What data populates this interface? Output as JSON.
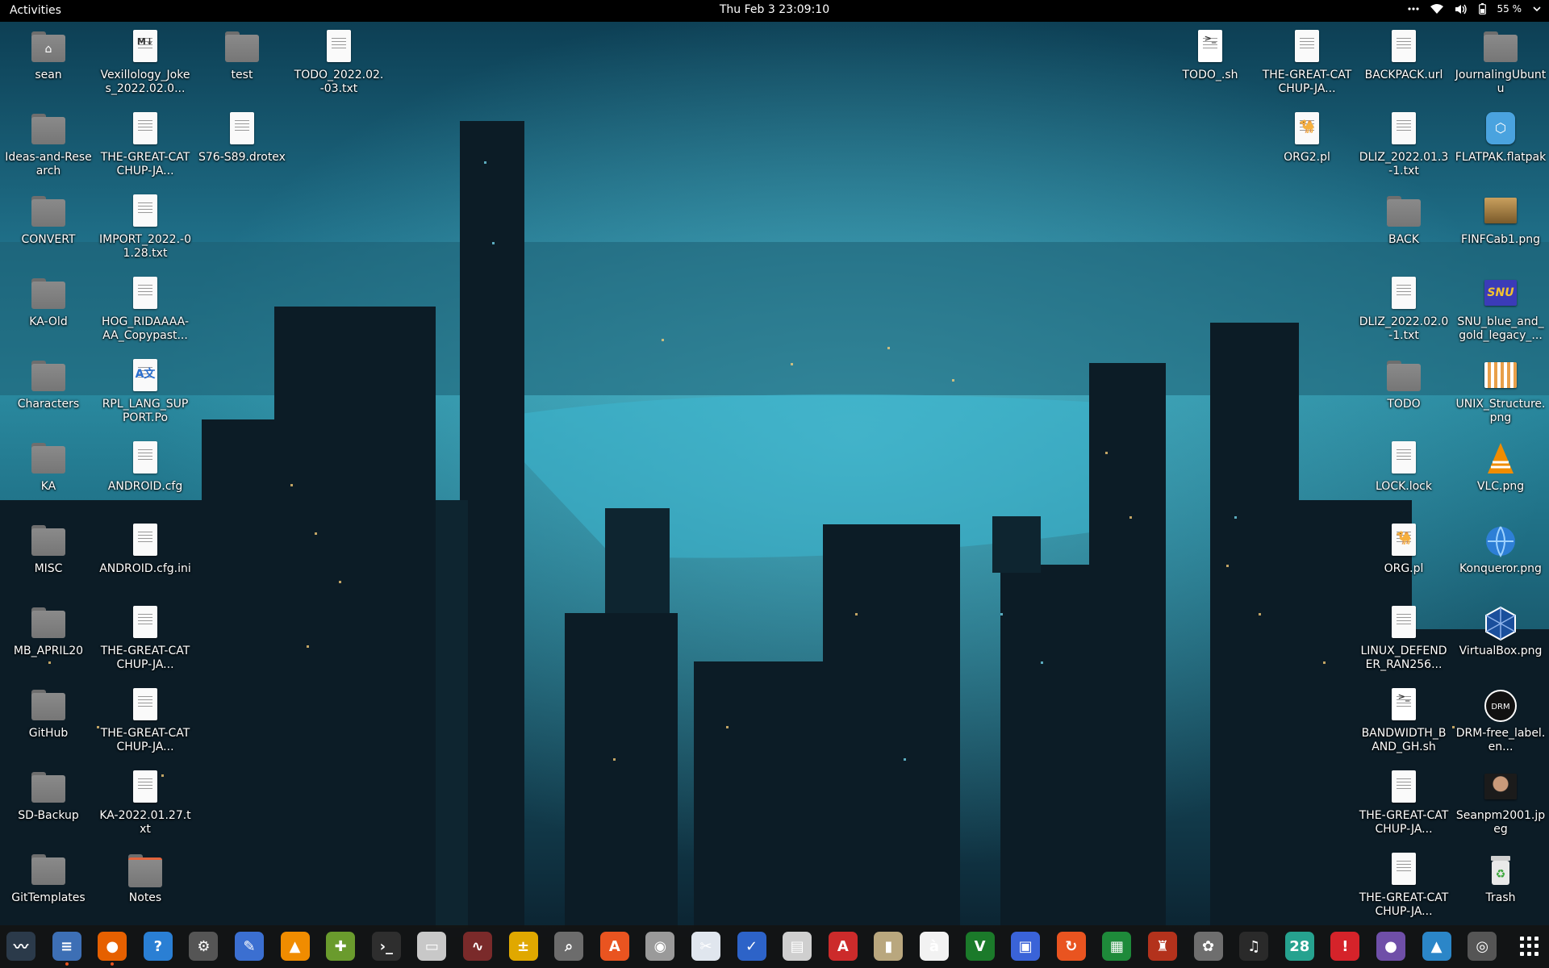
{
  "topbar": {
    "activities": "Activities",
    "clock": "Thu Feb 3  23:09:10",
    "battery": "55 %",
    "icons": [
      "more-icon",
      "wifi-icon",
      "volume-icon",
      "battery-icon",
      "system-menu-chevron-icon"
    ]
  },
  "desktop_icons": [
    {
      "label": "sean",
      "kind": "folder-home",
      "col": 0,
      "row": 0
    },
    {
      "label": "Ideas-and-Research",
      "kind": "folder",
      "col": 0,
      "row": 1
    },
    {
      "label": "CONVERT",
      "kind": "folder",
      "col": 0,
      "row": 2
    },
    {
      "label": "KA-Old",
      "kind": "folder",
      "col": 0,
      "row": 3
    },
    {
      "label": "Characters",
      "kind": "folder",
      "col": 0,
      "row": 4
    },
    {
      "label": "KA",
      "kind": "folder",
      "col": 0,
      "row": 5
    },
    {
      "label": "MISC",
      "kind": "folder",
      "col": 0,
      "row": 6
    },
    {
      "label": "MB_APRIL20",
      "kind": "folder",
      "col": 0,
      "row": 7
    },
    {
      "label": "GitHub",
      "kind": "folder",
      "col": 0,
      "row": 8
    },
    {
      "label": "SD-Backup",
      "kind": "folder",
      "col": 0,
      "row": 9
    },
    {
      "label": "GitTemplates",
      "kind": "folder",
      "col": 0,
      "row": 10
    },
    {
      "label": "Vexillology_Jokes_2022.02.0...",
      "kind": "markdown",
      "col": 1,
      "row": 0
    },
    {
      "label": "THE-GREAT-CATCHUP-JA...",
      "kind": "doc",
      "col": 1,
      "row": 1
    },
    {
      "label": "IMPORT_2022.-01.28.txt",
      "kind": "doc",
      "col": 1,
      "row": 2
    },
    {
      "label": "HOG_RIDAAAA-AA_Copypast...",
      "kind": "doc",
      "col": 1,
      "row": 3
    },
    {
      "label": "RPL_LANG_SUPPORT.Po",
      "kind": "translation",
      "col": 1,
      "row": 4
    },
    {
      "label": "ANDROID.cfg",
      "kind": "doc",
      "col": 1,
      "row": 5
    },
    {
      "label": "ANDROID.cfg.ini",
      "kind": "doc",
      "col": 1,
      "row": 6
    },
    {
      "label": "THE-GREAT-CATCHUP-JA...",
      "kind": "doc",
      "col": 1,
      "row": 7
    },
    {
      "label": "THE-GREAT-CATCHUP-JA...",
      "kind": "doc",
      "col": 1,
      "row": 8
    },
    {
      "label": "KA-2022.01.27.txt",
      "kind": "doc",
      "col": 1,
      "row": 9
    },
    {
      "label": "Notes",
      "kind": "folder-accent",
      "col": 1,
      "row": 10
    },
    {
      "label": "test",
      "kind": "folder",
      "col": 2,
      "row": 0
    },
    {
      "label": "S76-S89.drotex",
      "kind": "doc",
      "col": 2,
      "row": 1
    },
    {
      "label": "TODO_2022.02.-03.txt",
      "kind": "doc",
      "col": 3,
      "row": 0
    },
    {
      "label": "TODO_.sh",
      "kind": "script",
      "col": 12,
      "row": 0
    },
    {
      "label": "THE-GREAT-CATCHUP-JA...",
      "kind": "doc",
      "col": 13,
      "row": 0
    },
    {
      "label": "ORG2.pl",
      "kind": "perl",
      "col": 13,
      "row": 1
    },
    {
      "label": "BACKPACK.url",
      "kind": "doc",
      "col": 14,
      "row": 0
    },
    {
      "label": "DLIZ_2022.01.3-1.txt",
      "kind": "doc",
      "col": 14,
      "row": 1
    },
    {
      "label": "BACK",
      "kind": "folder",
      "col": 14,
      "row": 2
    },
    {
      "label": "DLIZ_2022.02.0-1.txt",
      "kind": "doc",
      "col": 14,
      "row": 3
    },
    {
      "label": "TODO",
      "kind": "folder",
      "col": 14,
      "row": 4
    },
    {
      "label": "LOCK.lock",
      "kind": "doc",
      "col": 14,
      "row": 5
    },
    {
      "label": "ORG.pl",
      "kind": "perl",
      "col": 14,
      "row": 6
    },
    {
      "label": "LINUX_DEFENDER_RAN256...",
      "kind": "doc",
      "col": 14,
      "row": 7
    },
    {
      "label": "BANDWIDTH_BAND_GH.sh",
      "kind": "script",
      "col": 14,
      "row": 8
    },
    {
      "label": "THE-GREAT-CATCHUP-JA...",
      "kind": "doc",
      "col": 14,
      "row": 9
    },
    {
      "label": "THE-GREAT-CATCHUP-JA...",
      "kind": "doc",
      "col": 14,
      "row": 10
    },
    {
      "label": "JournalingUbuntu",
      "kind": "folder",
      "col": 15,
      "row": 0
    },
    {
      "label": "FLATPAK.flatpak",
      "kind": "flatpak",
      "col": 15,
      "row": 1
    },
    {
      "label": "FINFCab1.png",
      "kind": "img-cabinet",
      "col": 15,
      "row": 2
    },
    {
      "label": "SNU_blue_and_gold_legacy_...",
      "kind": "img-snu",
      "col": 15,
      "row": 3
    },
    {
      "label": "UNIX_Structure.png",
      "kind": "img-chart",
      "col": 15,
      "row": 4
    },
    {
      "label": "VLC.png",
      "kind": "img-vlc",
      "col": 15,
      "row": 5
    },
    {
      "label": "Konqueror.png",
      "kind": "img-globe",
      "col": 15,
      "row": 6
    },
    {
      "label": "VirtualBox.png",
      "kind": "img-vbox",
      "col": 15,
      "row": 7
    },
    {
      "label": "DRM-free_label.en...",
      "kind": "img-drm",
      "col": 15,
      "row": 8
    },
    {
      "label": "Seanpm2001.jpeg",
      "kind": "img-photo",
      "col": 15,
      "row": 9
    },
    {
      "label": "Trash",
      "kind": "trash",
      "col": 15,
      "row": 10
    }
  ],
  "dock": [
    {
      "name": "system-monitor",
      "color": "#2b3a4a",
      "glyph": "〰",
      "running": false
    },
    {
      "name": "text-editor-docs",
      "color": "#3d6fb5",
      "glyph": "≡",
      "running": true
    },
    {
      "name": "firefox",
      "color": "#e66000",
      "glyph": "●",
      "running": true
    },
    {
      "name": "help",
      "color": "#2a7fd4",
      "glyph": "?",
      "running": false
    },
    {
      "name": "settings",
      "color": "#555",
      "glyph": "⚙",
      "running": false
    },
    {
      "name": "text-editor",
      "color": "#3b6fd1",
      "glyph": "✎",
      "running": false
    },
    {
      "name": "vlc",
      "color": "#f08c00",
      "glyph": "▲",
      "running": false
    },
    {
      "name": "extensions",
      "color": "#6a9b2d",
      "glyph": "✚",
      "running": false
    },
    {
      "name": "terminal",
      "color": "#2e2e2e",
      "glyph": "›_",
      "running": false
    },
    {
      "name": "files",
      "color": "#c8c8c8",
      "glyph": "▭",
      "running": false
    },
    {
      "name": "monitor-graph",
      "color": "#7a2a2a",
      "glyph": "∿",
      "running": false
    },
    {
      "name": "calculator",
      "color": "#e0a800",
      "glyph": "±",
      "running": false
    },
    {
      "name": "image-viewer",
      "color": "#6c6c6c",
      "glyph": "⌕",
      "running": false
    },
    {
      "name": "software",
      "color": "#e95420",
      "glyph": "A",
      "running": false
    },
    {
      "name": "disks",
      "color": "#9a9a9a",
      "glyph": "◉",
      "running": false
    },
    {
      "name": "screenshot",
      "color": "#e0e6ee",
      "glyph": "✂",
      "running": false
    },
    {
      "name": "tasks",
      "color": "#2d63c8",
      "glyph": "✓",
      "running": false
    },
    {
      "name": "document-viewer",
      "color": "#cfcfcf",
      "glyph": "▤",
      "running": false
    },
    {
      "name": "pdf-reader",
      "color": "#cc2b2b",
      "glyph": "A",
      "running": false
    },
    {
      "name": "archive-manager",
      "color": "#b9a77e",
      "glyph": "▮",
      "running": false
    },
    {
      "name": "character-map",
      "color": "#f2f2f2",
      "glyph": "à",
      "running": false
    },
    {
      "name": "vim",
      "color": "#1b7a2a",
      "glyph": "V",
      "running": false
    },
    {
      "name": "remote-desktop",
      "color": "#3a63d8",
      "glyph": "▣",
      "running": false
    },
    {
      "name": "update-manager",
      "color": "#e95420",
      "glyph": "↻",
      "running": false
    },
    {
      "name": "spreadsheet",
      "color": "#1e8a3a",
      "glyph": "▦",
      "running": false
    },
    {
      "name": "game-character",
      "color": "#b3321c",
      "glyph": "♜",
      "running": false
    },
    {
      "name": "gimp",
      "color": "#6e6e6e",
      "glyph": "✿",
      "running": false
    },
    {
      "name": "music",
      "color": "#2a2a2a",
      "glyph": "♫",
      "running": false
    },
    {
      "name": "calendar",
      "color": "#26a28f",
      "glyph": "28",
      "running": false
    },
    {
      "name": "error-reporter",
      "color": "#d5232a",
      "glyph": "!",
      "running": false
    },
    {
      "name": "screen-recorder",
      "color": "#6f4fa8",
      "glyph": "●",
      "running": false
    },
    {
      "name": "photo-app",
      "color": "#2b86c8",
      "glyph": "▲",
      "running": false
    },
    {
      "name": "ubuntu-software",
      "color": "#555",
      "glyph": "◎",
      "running": false
    }
  ],
  "colors": {
    "accent": "#e95420",
    "folder": "#7f7f7f",
    "topbar": "#000000",
    "dock": "#141414"
  }
}
